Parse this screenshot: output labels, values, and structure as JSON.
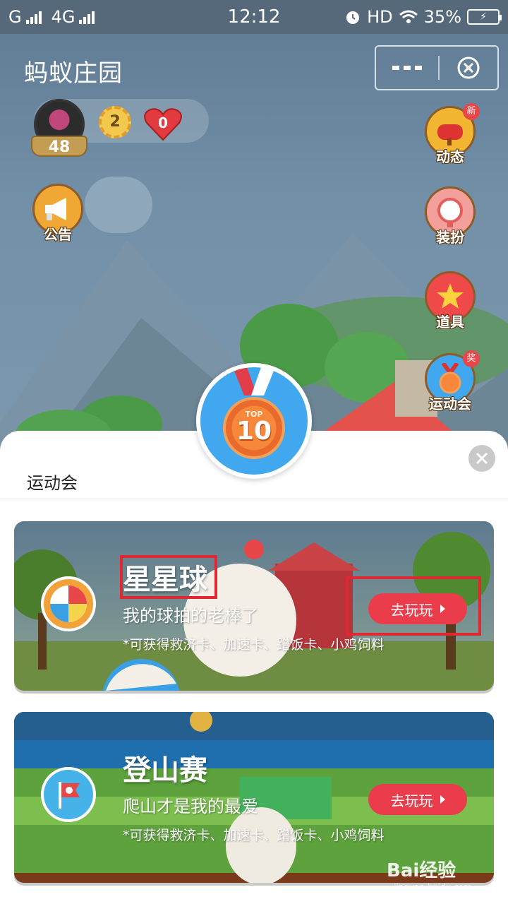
{
  "status_bar": {
    "carrier1": "G",
    "carrier2": "4G",
    "time": "12:12",
    "hd": "HD",
    "battery": "35%"
  },
  "header": {
    "title": "蚂蚁庄园"
  },
  "user": {
    "level": "48",
    "medals": "2",
    "hearts": "0"
  },
  "left_icons": [
    {
      "label": "公告",
      "icon": "megaphone-icon"
    }
  ],
  "right_icons": [
    {
      "label": "动态",
      "icon": "mailbox-icon",
      "tag": "新"
    },
    {
      "label": "装扮",
      "icon": "mirror-icon"
    },
    {
      "label": "道具",
      "icon": "star-icon"
    },
    {
      "label": "运动会",
      "icon": "medal-icon",
      "tag": "奖"
    }
  ],
  "medal": {
    "top_text": "TOP",
    "number": "10"
  },
  "sheet": {
    "title": "运动会",
    "cards": [
      {
        "name": "星星球",
        "subtitle": "我的球拍的老棒了",
        "note": "*可获得救济卡、加速卡、蹭饭卡、小鸡饲料",
        "button": "去玩玩",
        "icon": "beach-ball-icon"
      },
      {
        "name": "登山赛",
        "subtitle": "爬山才是我的最爱",
        "note": "*可获得救济卡、加速卡、蹭饭卡、小鸡饲料",
        "button": "去玩玩",
        "icon": "flag-icon"
      }
    ]
  },
  "watermark": {
    "brand": "Bai经验",
    "url": "jingyan.baidu.com"
  },
  "colors": {
    "accent_red": "#ea3c4a",
    "highlight_red": "#e02833",
    "medal_blue": "#41a8ef",
    "medal_orange": "#f7873b"
  }
}
